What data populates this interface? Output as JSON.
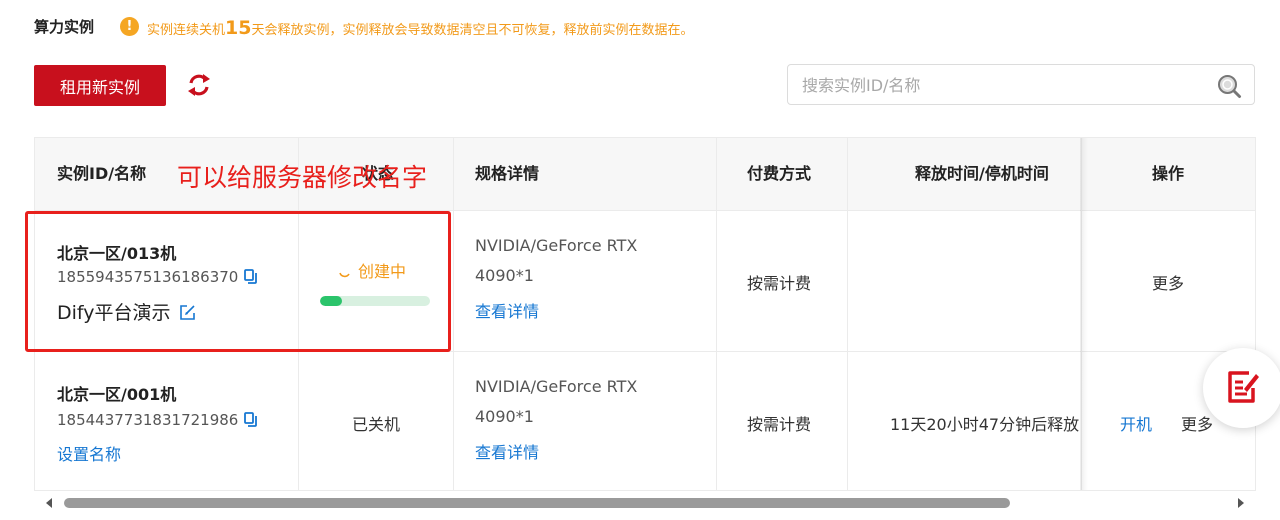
{
  "header": {
    "title": "算力实例",
    "notice_prefix": "实例连续关机",
    "notice_days": "15",
    "notice_suffix": "天会释放实例，实例释放会导致数据清空且不可恢复，释放前实例在数据在。"
  },
  "toolbar": {
    "rent_label": "租用新实例",
    "search_placeholder": "搜索实例ID/名称"
  },
  "table": {
    "columns": [
      "实例ID/名称",
      "状态",
      "规格详情",
      "付费方式",
      "释放时间/停机时间",
      "操作"
    ],
    "rows": [
      {
        "region": "北京一区/013机",
        "id": "1855943575136186370",
        "name": "Dify平台演示",
        "status": "创建中",
        "progress": 0.2,
        "spec_line1": "NVIDIA/GeForce RTX",
        "spec_line2": "4090*1",
        "spec_link": "查看详情",
        "billing": "按需计费",
        "release_time": "",
        "action_more": "更多"
      },
      {
        "region": "北京一区/001机",
        "id": "1854437731831721986",
        "set_name": "设置名称",
        "status": "已关机",
        "spec_line1": "NVIDIA/GeForce RTX",
        "spec_line2": "4090*1",
        "spec_link": "查看详情",
        "billing": "按需计费",
        "release_time": "11天20小时47分钟后释放",
        "action_start": "开机",
        "action_more": "更多"
      }
    ]
  },
  "annotation": {
    "text": "可以给服务器修改名字",
    "color": "#e8201c"
  },
  "colors": {
    "brand": "#c8101d",
    "link": "#1677d2",
    "warning": "#f29a1a",
    "progress": "#2bc46b"
  }
}
